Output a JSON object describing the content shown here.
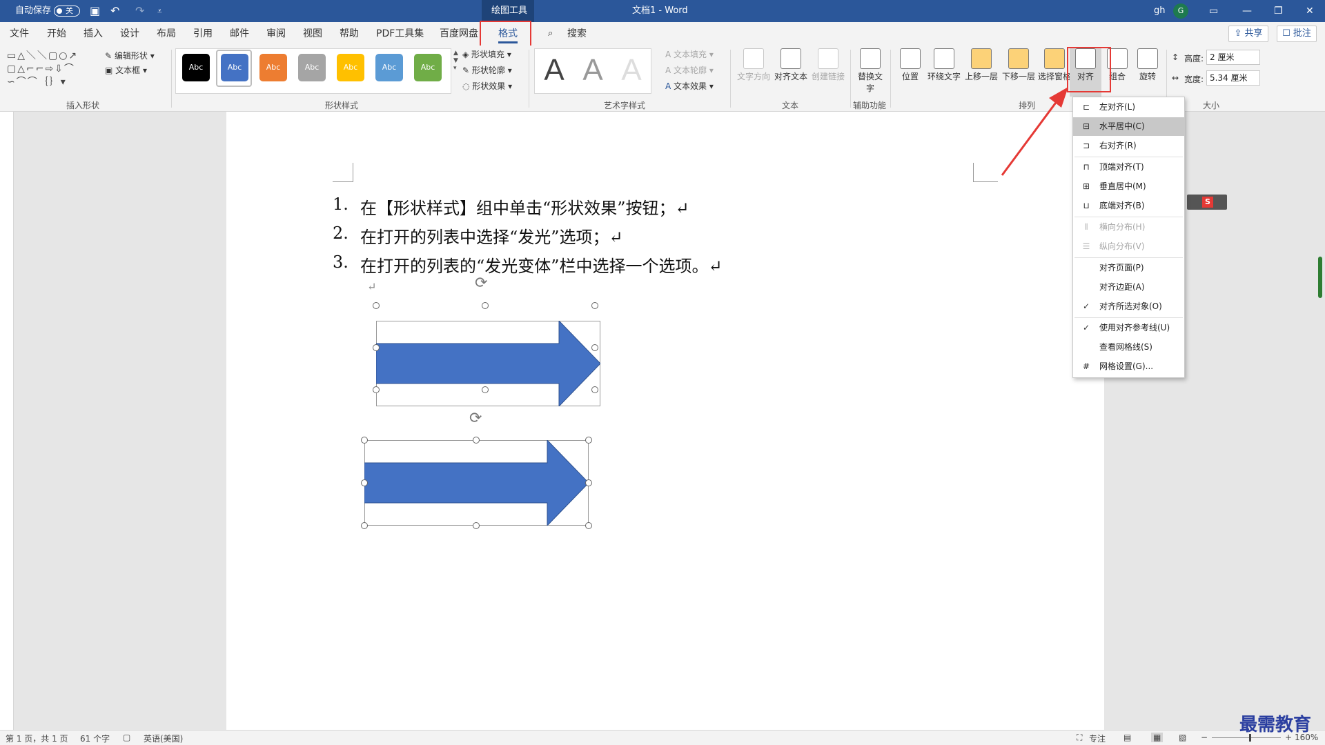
{
  "title_bar": {
    "autosave_label": "自动保存",
    "autosave_state": "关",
    "context_tool": "绘图工具",
    "doc_title": "文档1 - Word",
    "user": "gh",
    "avatar_letter": "G"
  },
  "menu": {
    "items": [
      "文件",
      "开始",
      "插入",
      "设计",
      "布局",
      "引用",
      "邮件",
      "审阅",
      "视图",
      "帮助",
      "PDF工具集",
      "百度网盘",
      "格式"
    ],
    "search": "搜索",
    "share": "共享",
    "comment": "批注"
  },
  "ribbon": {
    "insert_shapes": {
      "edit_shape": "编辑形状",
      "text_box": "文本框",
      "label": "插入形状"
    },
    "shape_styles": {
      "swatches": [
        {
          "text": "Abc",
          "color": "#000000"
        },
        {
          "text": "Abc",
          "color": "#4472c4"
        },
        {
          "text": "Abc",
          "color": "#ed7d31"
        },
        {
          "text": "Abc",
          "color": "#a5a5a5"
        },
        {
          "text": "Abc",
          "color": "#ffc000"
        },
        {
          "text": "Abc",
          "color": "#5b9bd5"
        },
        {
          "text": "Abc",
          "color": "#70ad47"
        }
      ],
      "fill": "形状填充",
      "outline": "形状轮廓",
      "effect": "形状效果",
      "label": "形状样式"
    },
    "wordart": {
      "letter": "A",
      "text_fill": "文本填充",
      "text_outline": "文本轮廓",
      "text_effect": "文本效果",
      "label": "艺术字样式"
    },
    "text": {
      "direction": "文字方向",
      "align_text": "对齐文本",
      "create_link": "创建链接",
      "label": "文本"
    },
    "accessibility": {
      "alt_text": "替换文字",
      "label": "辅助功能"
    },
    "arrange": {
      "position": "位置",
      "wrap": "环绕文字",
      "bring_forward": "上移一层",
      "send_backward": "下移一层",
      "selection_pane": "选择窗格",
      "align": "对齐",
      "group": "组合",
      "rotate": "旋转",
      "label": "排列"
    },
    "size": {
      "height_label": "高度:",
      "height_value": "2 厘米",
      "width_label": "宽度:",
      "width_value": "5.34 厘米",
      "label": "大小"
    }
  },
  "document": {
    "lines": [
      {
        "num": "1.",
        "text": "在【形状样式】组中单击“形状效果”按钮；↵"
      },
      {
        "num": "2.",
        "text": "在打开的列表中选择“发光”选项；↵"
      },
      {
        "num": "3.",
        "text": "在打开的列表的“发光变体”栏中选择一个选项。↵"
      }
    ],
    "para_mark": "↵"
  },
  "align_menu": [
    {
      "label": "左对齐(L)",
      "icon": "align-left-icon",
      "enabled": true,
      "checked": false
    },
    {
      "label": "水平居中(C)",
      "icon": "align-center-icon",
      "enabled": true,
      "checked": false,
      "highlighted": true
    },
    {
      "label": "右对齐(R)",
      "icon": "align-right-icon",
      "enabled": true,
      "checked": false
    },
    {
      "label": "顶端对齐(T)",
      "icon": "align-top-icon",
      "enabled": true,
      "checked": false
    },
    {
      "label": "垂直居中(M)",
      "icon": "align-middle-icon",
      "enabled": true,
      "checked": false
    },
    {
      "label": "底端对齐(B)",
      "icon": "align-bottom-icon",
      "enabled": true,
      "checked": false
    },
    {
      "label": "横向分布(H)",
      "icon": "distribute-horizontal-icon",
      "enabled": false,
      "checked": false
    },
    {
      "label": "纵向分布(V)",
      "icon": "distribute-vertical-icon",
      "enabled": false,
      "checked": false
    },
    {
      "label": "对齐页面(P)",
      "icon": "",
      "enabled": true,
      "checked": false
    },
    {
      "label": "对齐边距(A)",
      "icon": "",
      "enabled": true,
      "checked": false
    },
    {
      "label": "对齐所选对象(O)",
      "icon": "",
      "enabled": true,
      "checked": true
    },
    {
      "label": "使用对齐参考线(U)",
      "icon": "",
      "enabled": true,
      "checked": true
    },
    {
      "label": "查看网格线(S)",
      "icon": "",
      "enabled": true,
      "checked": false
    },
    {
      "label": "网格设置(G)...",
      "icon": "grid-settings-icon",
      "enabled": true,
      "checked": false
    }
  ],
  "status": {
    "page": "第 1 页，共 1 页",
    "words": "61 个字",
    "language": "英语(美国)",
    "focus": "专注",
    "zoom": "160%"
  },
  "watermark": "最需教育",
  "colors": {
    "brand": "#2b579a",
    "arrow_fill": "#4472c4",
    "highlight_red": "#e53935"
  }
}
